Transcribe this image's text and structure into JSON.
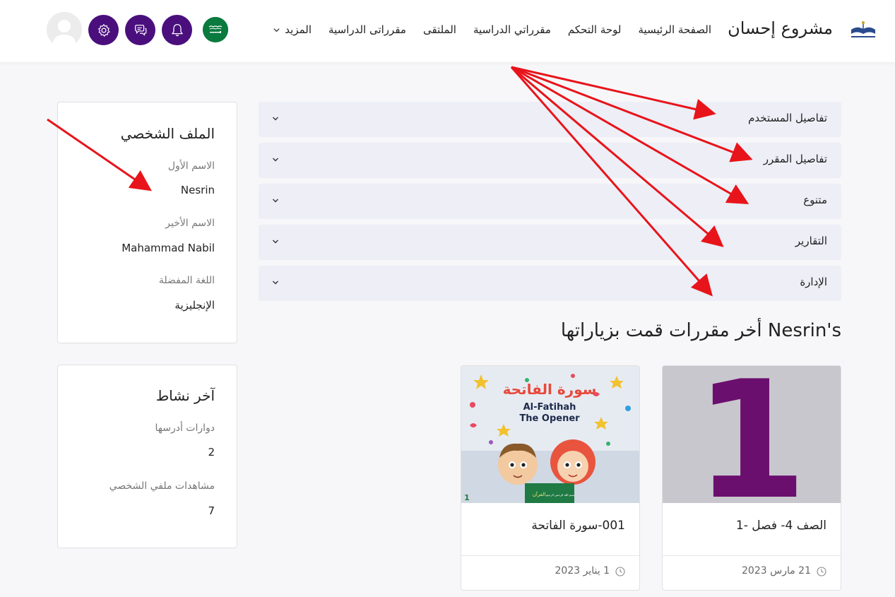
{
  "header": {
    "brand": "مشروع إحسان",
    "nav": [
      {
        "label": "الصفحة الرئيسية"
      },
      {
        "label": "لوحة التحكم"
      },
      {
        "label": "مقرراتي الدراسية"
      },
      {
        "label": "الملتقى"
      },
      {
        "label": "مقرراتى الدراسية"
      },
      {
        "label": "المزيد"
      }
    ],
    "icons": {
      "notifications": "bell-icon",
      "messages": "chat-bubbles-icon",
      "settings": "gear-icon",
      "language": "saudi-flag-icon",
      "user": "avatar"
    },
    "accent_color": "#4a0f7d"
  },
  "accordion": [
    {
      "label": "تفاصيل المستخدم"
    },
    {
      "label": "تفاصيل المقرر"
    },
    {
      "label": "متنوع"
    },
    {
      "label": "التقارير"
    },
    {
      "label": "الإدارة"
    }
  ],
  "recent": {
    "title": "Nesrin's أخر مقررات قمت بزياراتها",
    "courses": [
      {
        "title": "الصف 4- فصل -1",
        "date": "21 مارس 2023",
        "thumb_digit": "1"
      },
      {
        "title": "001-سورة الفاتحة",
        "date": "1 يناير 2023",
        "thumb_ar": "سورة الفاتحة",
        "thumb_en1": "Al-Fatihah",
        "thumb_en2": "The Opener",
        "book_label": "القرآن",
        "book_text": "بسم الله الرحمن الرحيم",
        "page_num": "1"
      }
    ]
  },
  "profile": {
    "title": "الملف الشخصي",
    "first_name_label": "الاسم الأول",
    "first_name": "Nesrin",
    "last_name_label": "الاسم الأخير",
    "last_name": "Mahammad Nabil",
    "language_label": "اللغة المفضلة",
    "language": "الإنجليزية"
  },
  "activity": {
    "title": "آخر نشاط",
    "courses_label": "دوارات أدرسها",
    "courses_value": "2",
    "views_label": "مشاهدات ملفي الشخصي",
    "views_value": "7"
  }
}
